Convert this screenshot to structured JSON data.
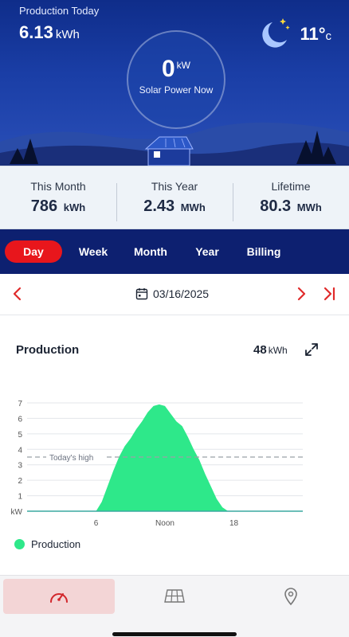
{
  "hero": {
    "production_today_label": "Production Today",
    "production_today_value": "6.13",
    "production_today_unit": "kWh",
    "weather_icon": "moon-stars-icon",
    "temperature_value": "11°",
    "temperature_unit": "c",
    "solar_power_value": "0",
    "solar_power_unit": "kW",
    "solar_power_caption": "Solar Power Now"
  },
  "stats": [
    {
      "label": "This Month",
      "value": "786",
      "unit": "kWh"
    },
    {
      "label": "This Year",
      "value": "2.43",
      "unit": "MWh"
    },
    {
      "label": "Lifetime",
      "value": "80.3",
      "unit": "MWh"
    }
  ],
  "tabs": [
    {
      "label": "Day",
      "active": true
    },
    {
      "label": "Week",
      "active": false
    },
    {
      "label": "Month",
      "active": false
    },
    {
      "label": "Year",
      "active": false
    },
    {
      "label": "Billing",
      "active": false
    }
  ],
  "date_nav": {
    "date": "03/16/2025",
    "prev_icon": "chevron-left-icon",
    "next_icon": "chevron-right-icon",
    "last_icon": "skip-to-end-icon"
  },
  "production": {
    "title": "Production",
    "total_value": "48",
    "total_unit": "kWh",
    "expand_icon": "expand-icon",
    "legend_label": "Production"
  },
  "chart_data": {
    "type": "area",
    "title": "Production",
    "ylabel": "kW",
    "ylim": [
      0,
      7
    ],
    "y_ticks": [
      "7",
      "6",
      "5",
      "4",
      "3",
      "2",
      "1",
      "kW"
    ],
    "x_tick_labels": [
      "6",
      "Noon",
      "18"
    ],
    "reference_line": {
      "label": "Today's high",
      "value": 3.5
    },
    "series": [
      {
        "name": "Production",
        "color": "#2ee88a",
        "points": [
          [
            0,
            0
          ],
          [
            6,
            0
          ],
          [
            6.5,
            0.6
          ],
          [
            7,
            1.6
          ],
          [
            7.5,
            2.6
          ],
          [
            8,
            3.5
          ],
          [
            8.5,
            4.2
          ],
          [
            9,
            4.7
          ],
          [
            9.5,
            5.3
          ],
          [
            10,
            5.8
          ],
          [
            10.5,
            6.4
          ],
          [
            11,
            6.8
          ],
          [
            11.5,
            6.9
          ],
          [
            12,
            6.8
          ],
          [
            12.5,
            6.3
          ],
          [
            13,
            5.8
          ],
          [
            13.5,
            5.5
          ],
          [
            14,
            4.8
          ],
          [
            14.5,
            4.0
          ],
          [
            15,
            3.3
          ],
          [
            15.5,
            2.4
          ],
          [
            16,
            1.6
          ],
          [
            16.5,
            0.8
          ],
          [
            17,
            0.25
          ],
          [
            17.5,
            0
          ],
          [
            24,
            0
          ]
        ]
      }
    ],
    "grid": true,
    "legend": "bottom-left"
  },
  "bottom_nav": [
    {
      "name": "dashboard-gauge-icon",
      "active": true
    },
    {
      "name": "solar-panel-icon",
      "active": false
    },
    {
      "name": "location-pin-icon",
      "active": false
    }
  ],
  "colors": {
    "accent_red": "#e8161c",
    "nav_blue": "#0d2070",
    "production_green": "#2ee88a"
  }
}
